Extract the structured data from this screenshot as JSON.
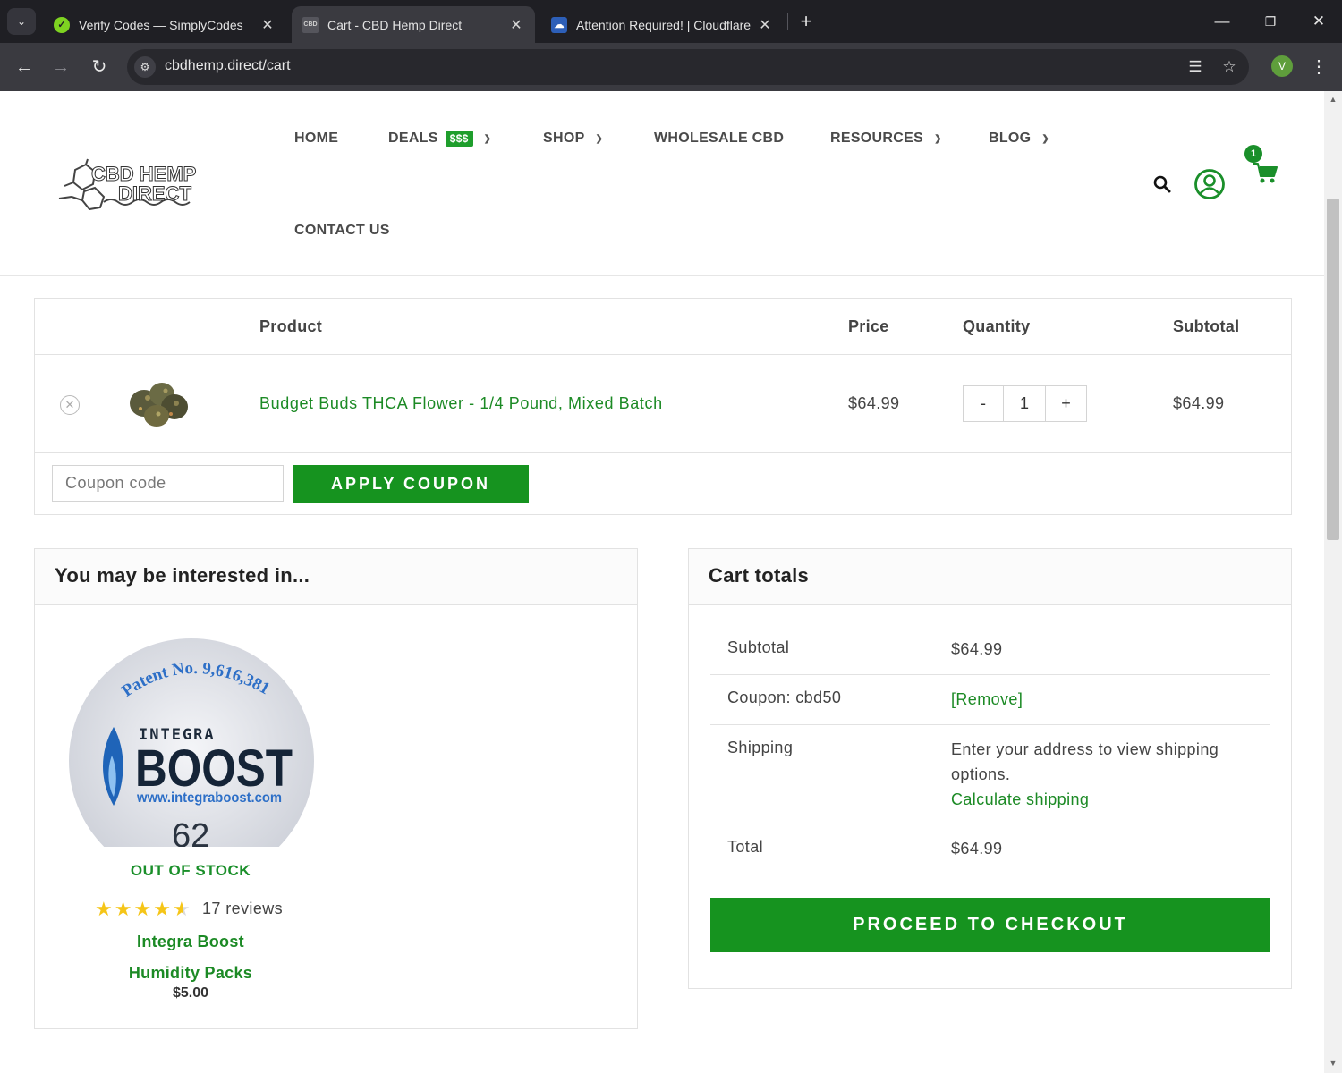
{
  "browser": {
    "tabs": [
      {
        "title": "Verify Codes — SimplyCodes",
        "active": false
      },
      {
        "title": "Cart - CBD Hemp Direct",
        "active": true
      },
      {
        "title": "Attention Required! | Cloudflare",
        "active": false
      }
    ],
    "url": "cbdhemp.direct/cart",
    "profile_initial": "V"
  },
  "site": {
    "logo_line1": "CBD HEMP",
    "logo_line2": "DIRECT",
    "nav": {
      "home": "HOME",
      "deals": "DEALS",
      "deals_badge": "$$$",
      "shop": "SHOP",
      "wholesale": "WHOLESALE CBD",
      "resources": "RESOURCES",
      "blog": "BLOG",
      "contact": "CONTACT US"
    },
    "cart_count": "1"
  },
  "cart": {
    "headers": {
      "product": "Product",
      "price": "Price",
      "quantity": "Quantity",
      "subtotal": "Subtotal"
    },
    "item": {
      "name": "Budget Buds THCA Flower - 1/4 Pound, Mixed Batch",
      "price": "$64.99",
      "quantity": "1",
      "subtotal": "$64.99",
      "minus": "-",
      "plus": "+"
    },
    "coupon_placeholder": "Coupon code",
    "apply_label": "APPLY COUPON"
  },
  "interested": {
    "title": "You may be interested in...",
    "product": {
      "image_text": {
        "patent": "Patent No. 9,616,381",
        "brand_top": "INTEGRA",
        "brand_main": "BOOST",
        "website": "www.integraboost.com",
        "number": "62"
      },
      "stock": "OUT OF STOCK",
      "rating": 4.5,
      "reviews": "17 reviews",
      "name": "Integra Boost Humidity Packs",
      "price": "$5.00"
    }
  },
  "totals": {
    "title": "Cart totals",
    "subtotal_label": "Subtotal",
    "subtotal_value": "$64.99",
    "coupon_label": "Coupon: cbd50",
    "coupon_remove": "[Remove]",
    "shipping_label": "Shipping",
    "shipping_text": "Enter your address to view shipping options.",
    "shipping_link": "Calculate shipping",
    "total_label": "Total",
    "total_value": "$64.99",
    "checkout_label": "PROCEED TO CHECKOUT"
  },
  "colors": {
    "brand_green": "#16931f",
    "link_green": "#1c8a25",
    "star": "#f5c518"
  }
}
